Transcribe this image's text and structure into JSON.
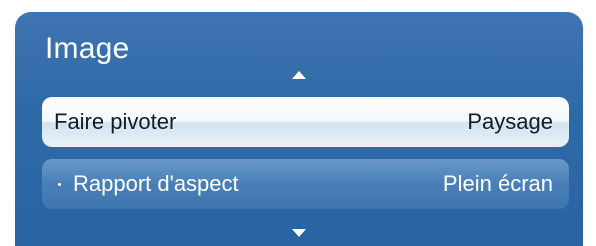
{
  "panel": {
    "title": "Image"
  },
  "menu": {
    "items": [
      {
        "label": "Faire pivoter",
        "value": "Paysage"
      },
      {
        "label": "Rapport d'aspect",
        "value": "Plein écran"
      }
    ]
  },
  "icons": {
    "scroll_up": "arrow-up-icon",
    "scroll_down": "arrow-down-icon"
  },
  "colors": {
    "panel_background": "#2f6aa8",
    "selected_row": "#ffffff",
    "row_background": "#4a80b9"
  }
}
